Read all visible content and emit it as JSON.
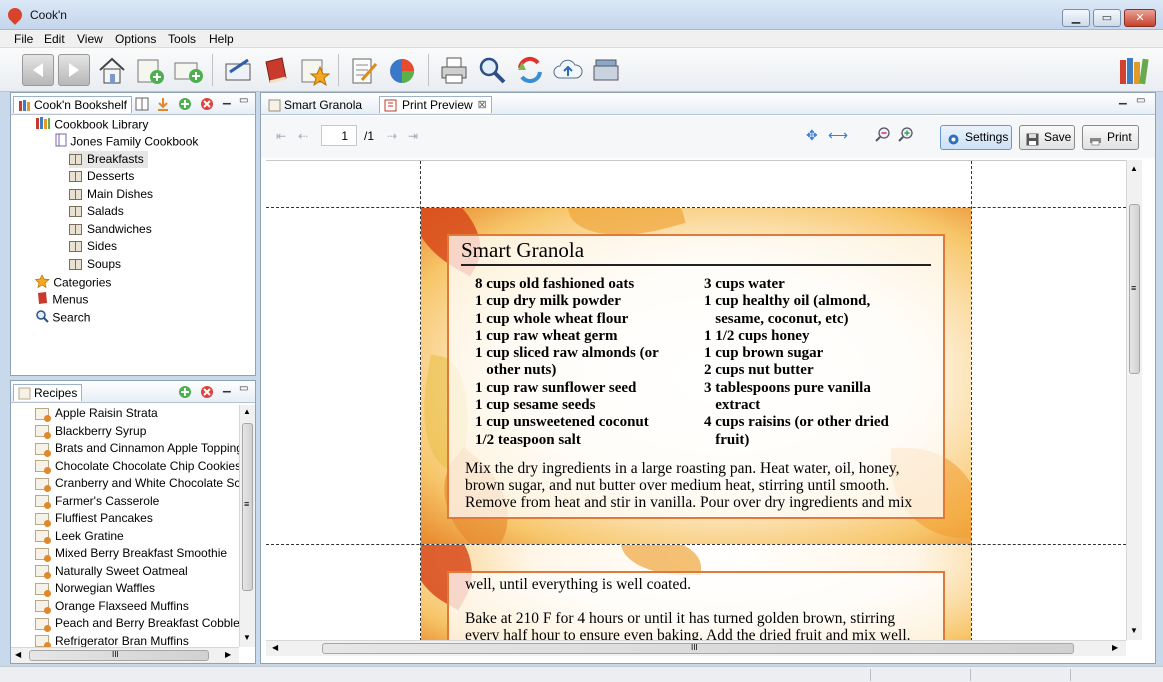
{
  "window": {
    "title": "Cook'n"
  },
  "menu": [
    "File",
    "Edit",
    "View",
    "Options",
    "Tools",
    "Help"
  ],
  "toolbar_icons": [
    "back-arrow-icon",
    "forward-arrow-icon",
    "home-icon",
    "new-cookbook-icon",
    "new-chapter-icon",
    "edit-recipe-icon",
    "cookbook-icon",
    "favorites-folder-icon",
    "menu-planner-icon",
    "nutrition-icon",
    "print-icon",
    "search-icon",
    "sync-icon",
    "cloud-upload-icon",
    "scanner-icon",
    "library-icon"
  ],
  "bookshelf": {
    "tab": "Cook'n Bookshelf",
    "library": "Cookbook Library",
    "cookbook": "Jones Family Cookbook",
    "categories": [
      "Breakfasts",
      "Desserts",
      "Main Dishes",
      "Salads",
      "Sandwiches",
      "Sides",
      "Soups"
    ],
    "extras": [
      "Categories",
      "Menus",
      "Search"
    ]
  },
  "recipes": {
    "tab": "Recipes",
    "items": [
      "Apple Raisin Strata",
      "Blackberry Syrup",
      "Brats and Cinnamon Apple Topping",
      "Chocolate Chocolate Chip Cookies",
      "Cranberry and White Chocolate Scones",
      "Farmer's Casserole",
      "Fluffiest Pancakes",
      "Leek Gratine",
      "Mixed Berry Breakfast Smoothie",
      "Naturally Sweet Oatmeal",
      "Norwegian Waffles",
      "Orange Flaxseed Muffins",
      "Peach and Berry Breakfast Cobbler",
      "Refrigerator Bran Muffins"
    ],
    "hscroll_grip": "III"
  },
  "tabs": {
    "recipe_tab": "Smart Granola",
    "preview_tab": "Print Preview"
  },
  "preview_toolbar": {
    "page": "1",
    "page_total": "/1",
    "settings": "Settings",
    "save": "Save",
    "print": "Print"
  },
  "recipe": {
    "title": "Smart Granola",
    "left": "8 cups old fashioned oats\n1 cup dry milk powder\n1 cup whole wheat flour\n1 cup raw wheat germ\n1 cup sliced raw almonds (or\n   other nuts)\n1 cup raw sunflower seed\n1 cup sesame seeds\n1 cup unsweetened coconut\n1/2 teaspoon salt",
    "right": "3 cups water\n1 cup healthy oil (almond,\n   sesame, coconut, etc)\n1 1/2 cups honey\n1 cup brown sugar\n2 cups nut butter\n3 tablespoons pure vanilla\n   extract\n4 cups raisins (or other dried\n   fruit)",
    "directions1": "Mix the dry ingredients in a large roasting pan. Heat water, oil, honey, brown sugar, and nut butter over medium heat, stirring until smooth. Remove from heat and stir in vanilla. Pour over dry ingredients and mix",
    "directions2a": "well, until everything is well coated.",
    "directions2b": "Bake at 210 F for 4 hours or until it has turned golden brown, stirring every half hour to ensure even baking. Add the dried fruit and mix well."
  },
  "scroll_grip": {
    "vertical": "≡",
    "horizontal": "III"
  }
}
